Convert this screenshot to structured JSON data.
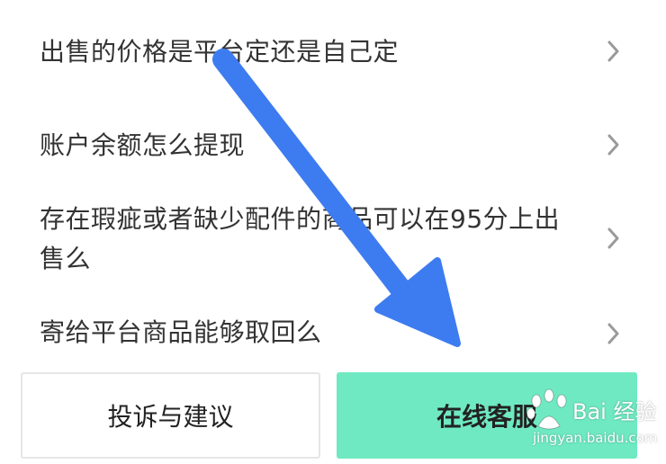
{
  "faq": {
    "items": [
      {
        "question": "出售的价格是平台定还是自己定"
      },
      {
        "question": "账户余额怎么提现"
      },
      {
        "question": "存在瑕疵或者缺少配件的商品可以在95分上出售么"
      },
      {
        "question": "寄给平台商品能够取回么"
      }
    ]
  },
  "actions": {
    "complaint_label": "投诉与建议",
    "service_label": "在线客服",
    "service_color": "#6fe9c1"
  },
  "annotation": {
    "arrow_color": "#3d7cf0",
    "arrow_icon": "blue-arrow-pointing-down-right"
  },
  "watermark": {
    "name": "Bai 经验",
    "url": "jingyan.baidu.com"
  }
}
